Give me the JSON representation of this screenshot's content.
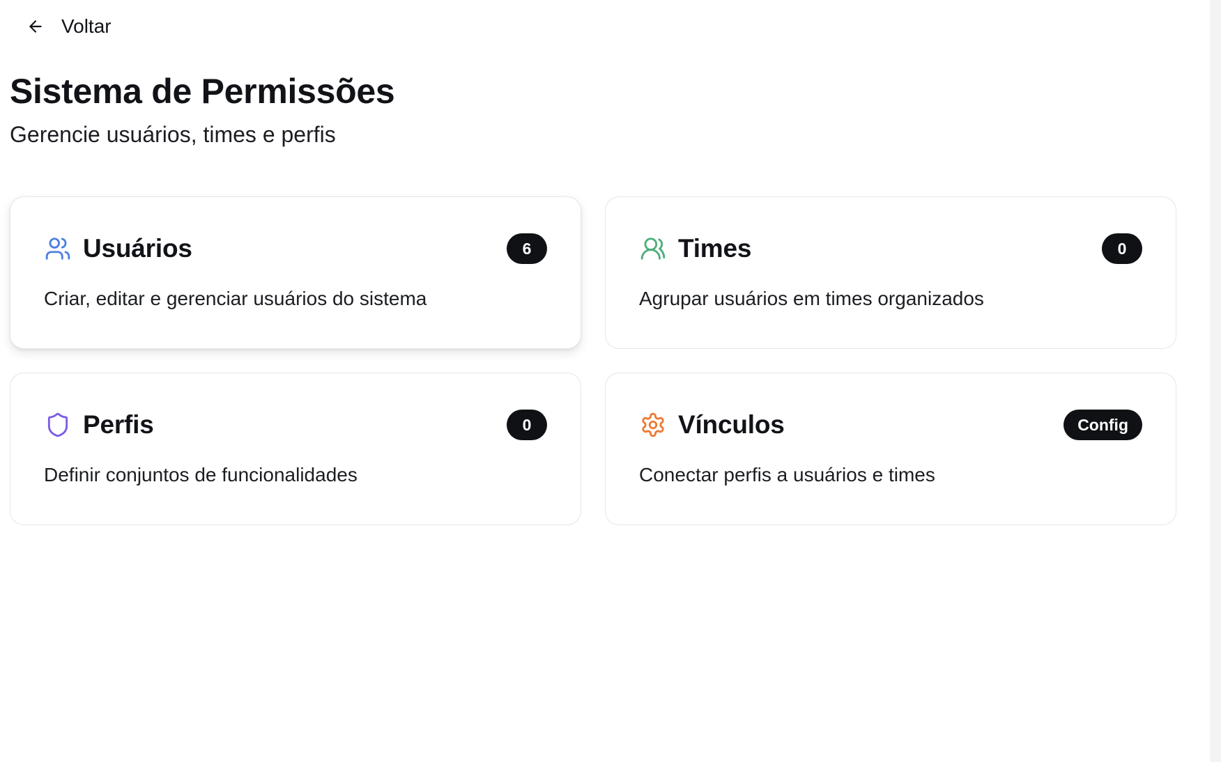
{
  "nav": {
    "back_label": "Voltar",
    "back_icon": "arrow-left-icon"
  },
  "header": {
    "title": "Sistema de Permissões",
    "subtitle": "Gerencie usuários, times e perfis"
  },
  "cards": [
    {
      "title": "Usuários",
      "badge": "6",
      "description": "Criar, editar e gerenciar usuários do sistema",
      "icon": "users-icon",
      "icon_color": "#4f7fe0"
    },
    {
      "title": "Times",
      "badge": "0",
      "description": "Agrupar usuários em times organizados",
      "icon": "users-icon",
      "icon_color": "#4fae7c"
    },
    {
      "title": "Perfis",
      "badge": "0",
      "description": "Definir conjuntos de funcionalidades",
      "icon": "shield-icon",
      "icon_color": "#7a5ce6"
    },
    {
      "title": "Vínculos",
      "badge": "Config",
      "description": "Conectar perfis a usuários e times",
      "icon": "gear-icon",
      "icon_color": "#ec7a34"
    }
  ]
}
